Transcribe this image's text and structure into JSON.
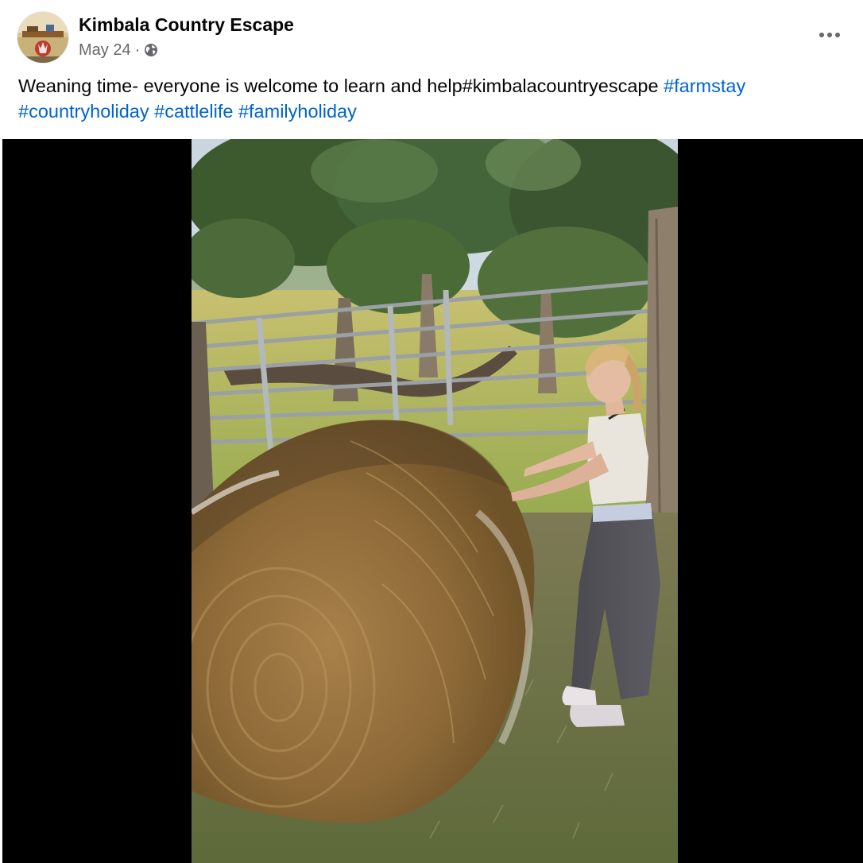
{
  "page": {
    "name": "Kimbala Country Escape",
    "date": "May 24",
    "separator": "·",
    "audience_icon": "globe-icon",
    "more_icon": "ellipsis-icon"
  },
  "caption": {
    "text": "Weaning time- everyone is welcome to learn and help#kimbalacountryescape ",
    "hashtags": [
      "#farmstay",
      "#countryholiday",
      "#cattlelife",
      "#familyholiday"
    ]
  },
  "media": {
    "type": "video",
    "scene": "woman-unwrapping-round-hay-bale-in-cattle-yard"
  },
  "colors": {
    "link": "#0064d1",
    "secondary_text": "#65676b",
    "primary_text": "#050505",
    "media_background": "#000000"
  }
}
